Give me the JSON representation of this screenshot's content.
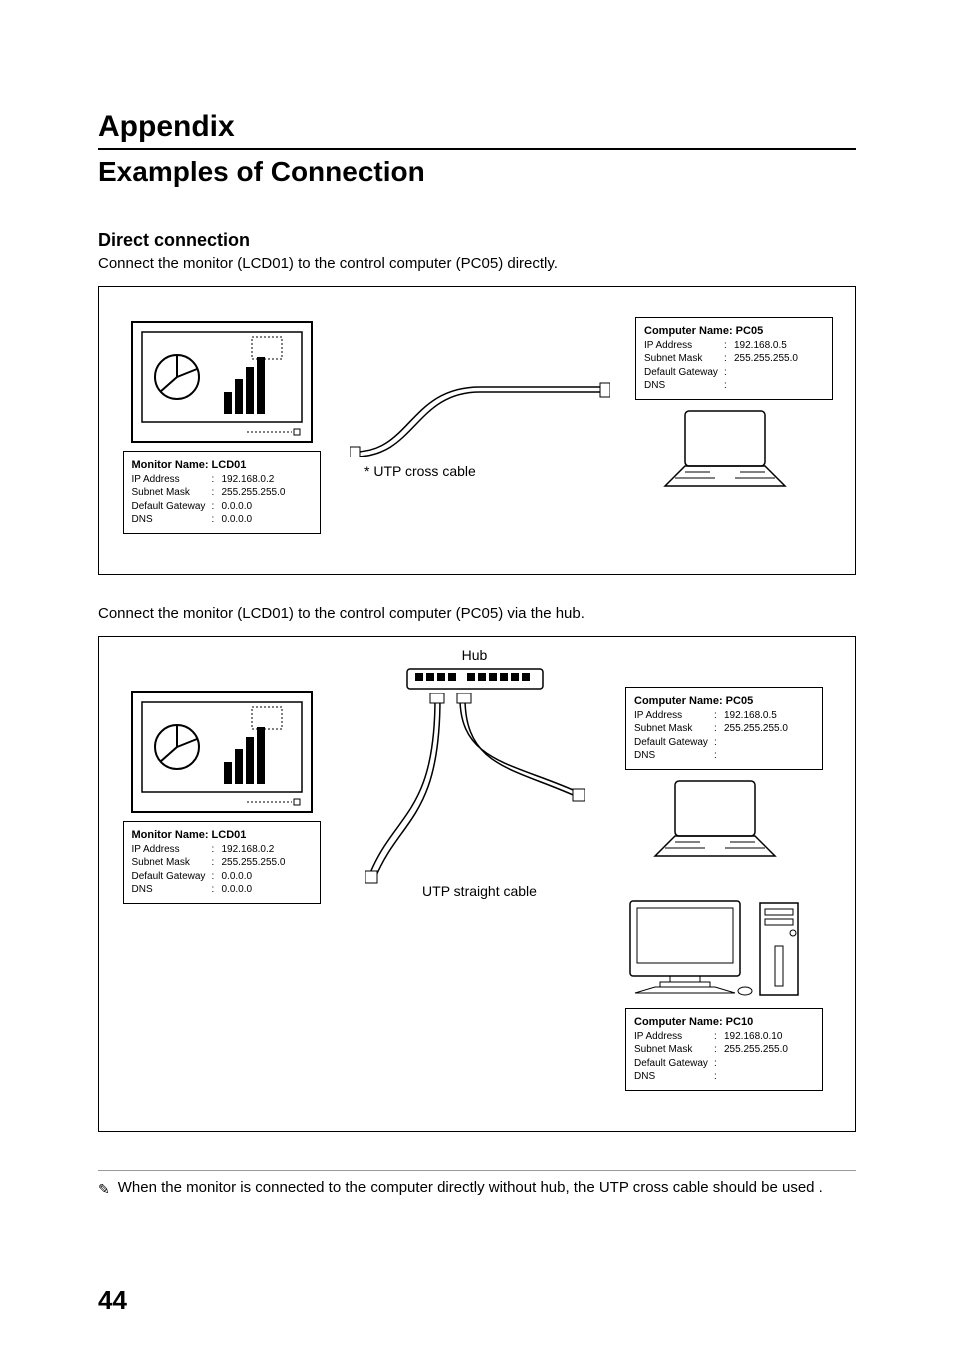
{
  "headings": {
    "appendix": "Appendix",
    "examples": "Examples of Connection",
    "direct": "Direct connection"
  },
  "body": {
    "p1": "Connect the monitor (LCD01) to the control computer (PC05) directly.",
    "p2": "Connect the monitor (LCD01) to the control computer (PC05) via the hub."
  },
  "figure1": {
    "monitor": {
      "title": "Monitor Name: LCD01",
      "ip_label": "IP Address",
      "ip": "192.168.0.2",
      "sm_label": "Subnet Mask",
      "sm": "255.255.255.0",
      "dg_label": "Default Gateway",
      "dg": "0.0.0.0",
      "dns_label": "DNS",
      "dns": "0.0.0.0"
    },
    "cable": "* UTP cross cable",
    "computer": {
      "title": "Computer Name: PC05",
      "ip_label": "IP Address",
      "ip": "192.168.0.5",
      "sm_label": "Subnet Mask",
      "sm": "255.255.255.0",
      "dg_label": "Default Gateway",
      "dg": "",
      "dns_label": "DNS",
      "dns": ""
    }
  },
  "figure2": {
    "hub_label": "Hub",
    "monitor": {
      "title": "Monitor Name: LCD01",
      "ip_label": "IP Address",
      "ip": "192.168.0.2",
      "sm_label": "Subnet Mask",
      "sm": "255.255.255.0",
      "dg_label": "Default Gateway",
      "dg": "0.0.0.0",
      "dns_label": "DNS",
      "dns": "0.0.0.0"
    },
    "cable": "UTP straight cable",
    "computer_a": {
      "title": "Computer Name: PC05",
      "ip_label": "IP Address",
      "ip": "192.168.0.5",
      "sm_label": "Subnet Mask",
      "sm": "255.255.255.0",
      "dg_label": "Default Gateway",
      "dg": "",
      "dns_label": "DNS",
      "dns": ""
    },
    "computer_b": {
      "title": "Computer Name: PC10",
      "ip_label": "IP Address",
      "ip": "192.168.0.10",
      "sm_label": "Subnet Mask",
      "sm": "255.255.255.0",
      "dg_label": "Default Gateway",
      "dg": "",
      "dns_label": "DNS",
      "dns": ""
    }
  },
  "footnote_icon": "✎",
  "footnote": "When the monitor is connected to the computer directly without hub, the UTP cross cable should be used .",
  "page_number": "44"
}
